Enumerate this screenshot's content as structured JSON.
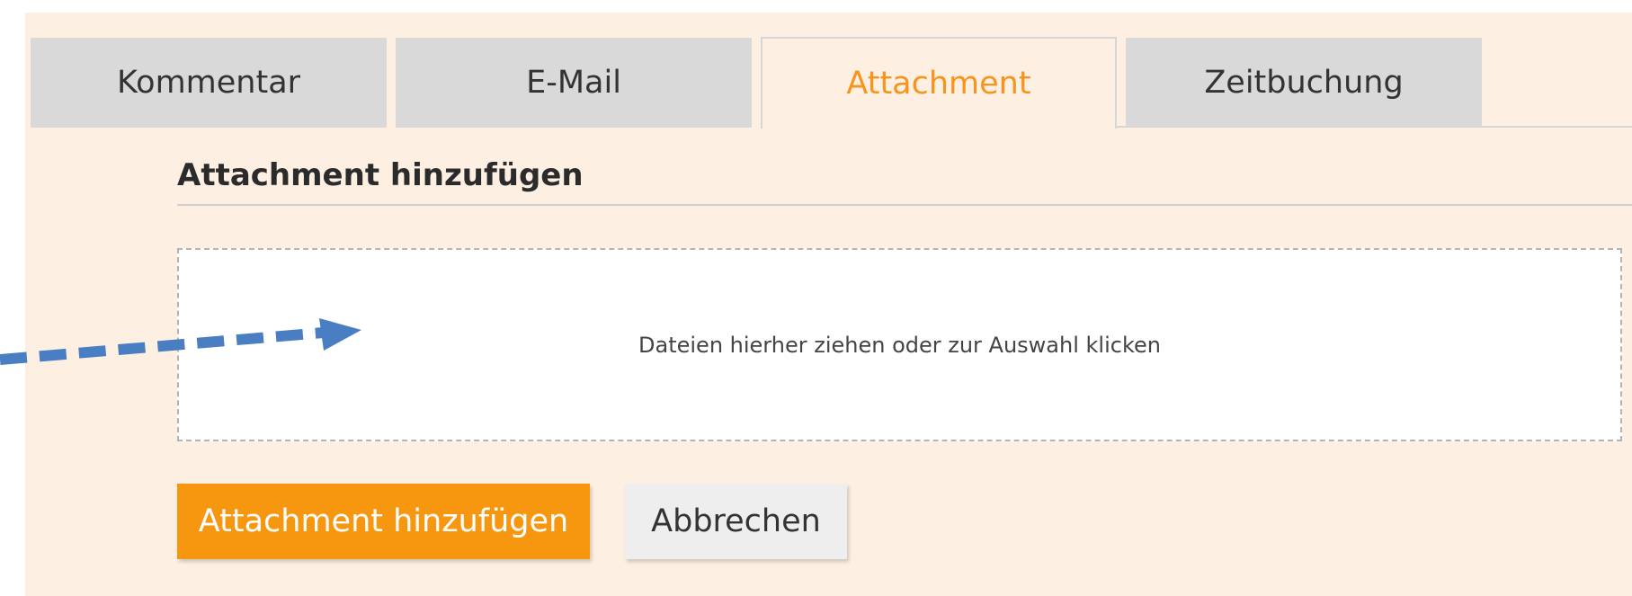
{
  "tabs": [
    {
      "label": "Kommentar",
      "active": false
    },
    {
      "label": "E-Mail",
      "active": false
    },
    {
      "label": "Attachment",
      "active": true
    },
    {
      "label": "Zeitbuchung",
      "active": false
    }
  ],
  "section": {
    "title": "Attachment hinzufügen"
  },
  "dropzone": {
    "text": "Dateien hierher ziehen oder zur Auswahl klicken"
  },
  "buttons": {
    "submit_label": "Attachment hinzufügen",
    "cancel_label": "Abbrechen"
  },
  "colors": {
    "panel_background": "#fdf0e3",
    "accent": "#f7941d",
    "tab_inactive": "#d9d9d9",
    "arrow": "#4a7ec2"
  }
}
